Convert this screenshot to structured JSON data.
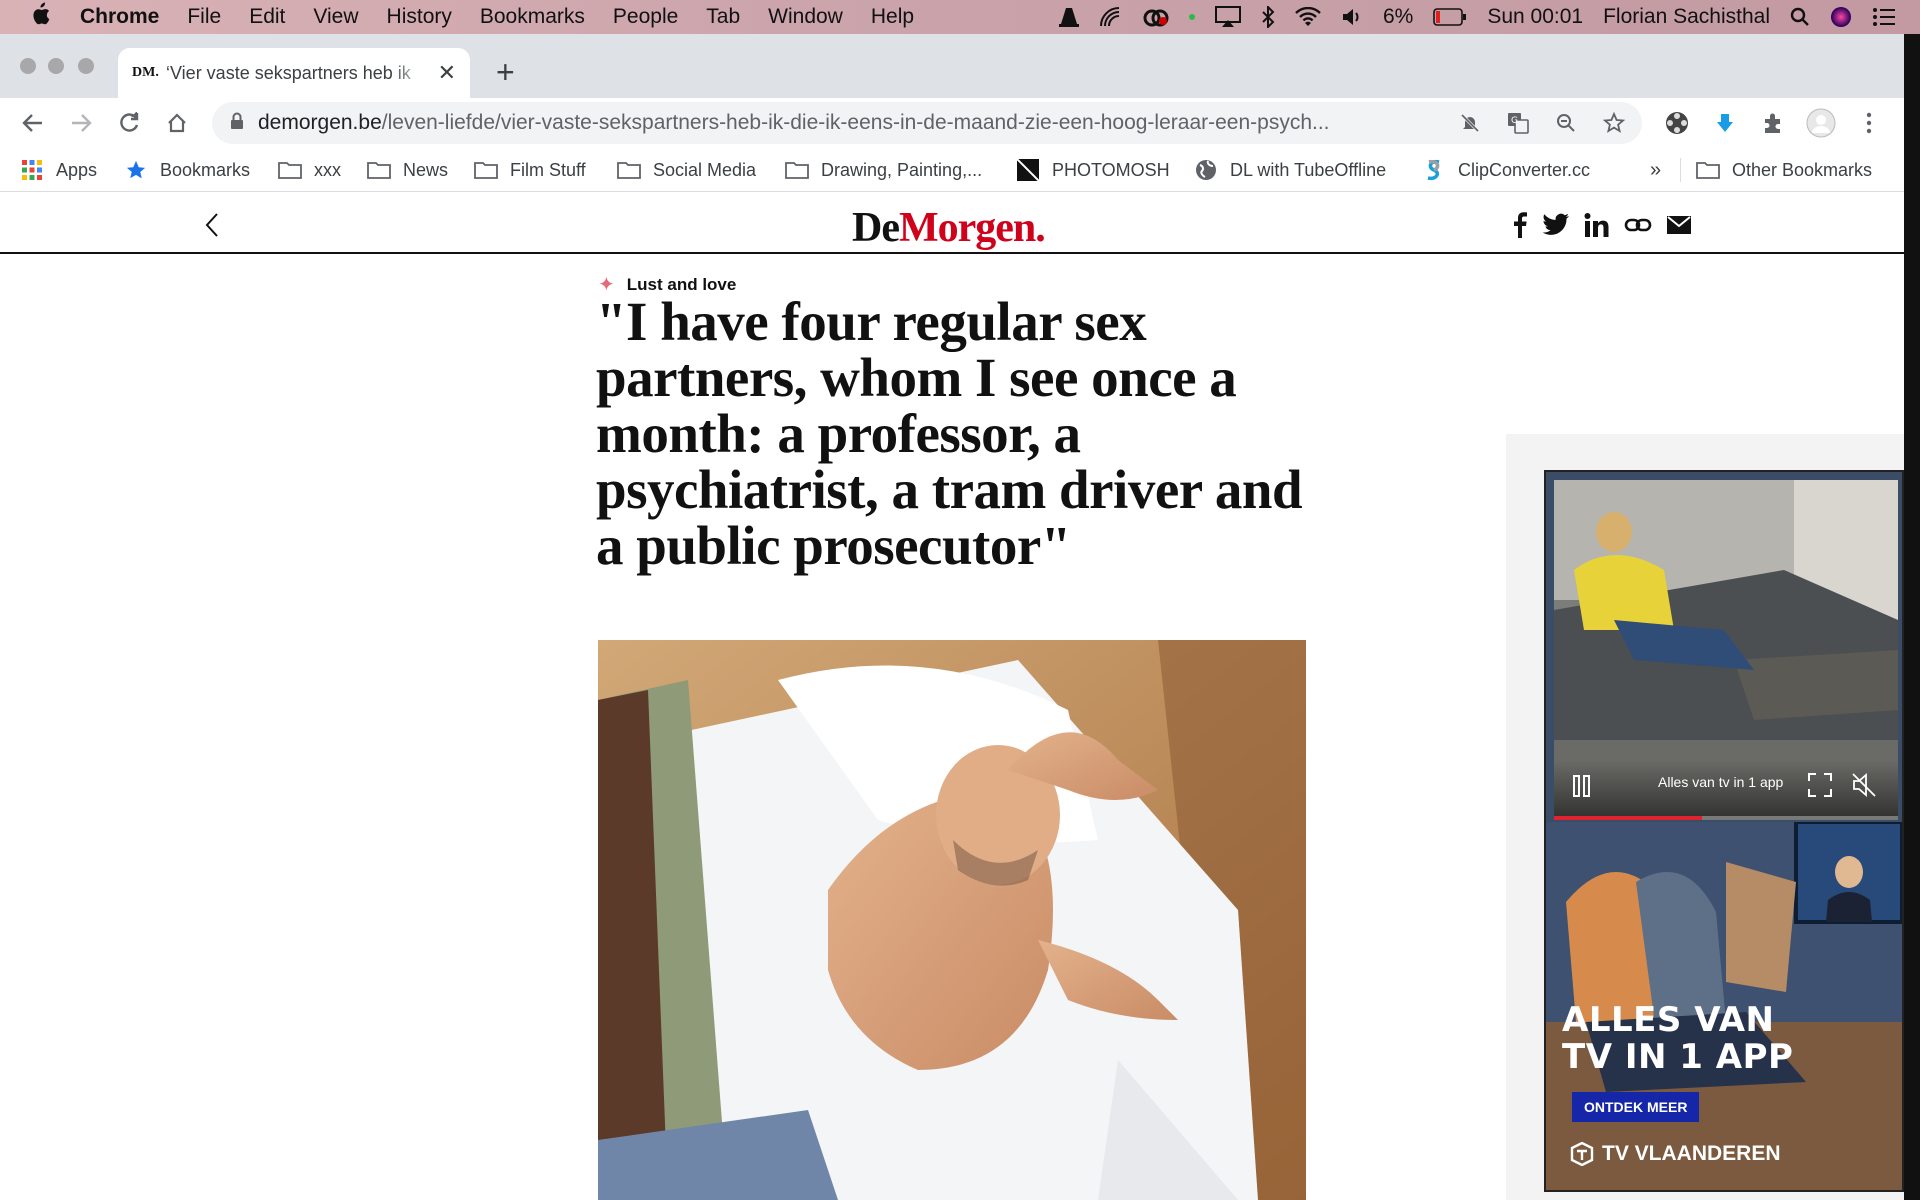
{
  "menubar": {
    "app_name": "Chrome",
    "items": [
      "File",
      "Edit",
      "View",
      "History",
      "Bookmarks",
      "People",
      "Tab",
      "Window",
      "Help"
    ],
    "battery": "6%",
    "clock": "Sun 00:01",
    "user": "Florian Sachisthal"
  },
  "tab": {
    "favicon_text": "DM.",
    "title": "‘Vier vaste sekspartners heb ik"
  },
  "address": {
    "host": "demorgen.be",
    "path": "/leven-liefde/vier-vaste-sekspartners-heb-ik-die-ik-eens-in-de-maand-zie-een-hoog-leraar-een-psych..."
  },
  "bookmarks": [
    {
      "label": "Apps",
      "icon": "apps-grid-icon"
    },
    {
      "label": "Bookmarks",
      "icon": "star-icon"
    },
    {
      "label": "xxx",
      "icon": "folder-icon"
    },
    {
      "label": "News",
      "icon": "folder-icon"
    },
    {
      "label": "Film Stuff",
      "icon": "folder-icon"
    },
    {
      "label": "Social Media",
      "icon": "folder-icon"
    },
    {
      "label": "Drawing, Painting,...",
      "icon": "folder-icon"
    },
    {
      "label": "PHOTOMOSH",
      "icon": "photomosh-icon"
    },
    {
      "label": "DL with TubeOffline",
      "icon": "globe-icon"
    },
    {
      "label": "ClipConverter.cc",
      "icon": "clipconverter-icon"
    }
  ],
  "bookmarks_overflow": "»",
  "other_bookmarks": "Other Bookmarks",
  "site": {
    "logo_de": "De",
    "logo_morgen": "Morgen",
    "logo_dot": "."
  },
  "article": {
    "kicker": "Lust and love",
    "headline": "\"I have four regular sex partners, whom I see once a month: a professor, a psychiatrist, a tram driver and a public prosecutor\""
  },
  "ad": {
    "video_caption": "Alles van tv in 1 app",
    "video_progress": 0.43,
    "title_line1": "ALLES VAN",
    "title_line2": "TV IN 1 APP",
    "button": "ONTDEK MEER",
    "brand": "TV VLAANDEREN"
  },
  "colors": {
    "brand_red": "#d0021b",
    "kicker_star": "#e56b7a",
    "ad_button": "#1626a8",
    "menubar": "#c9a2aa"
  }
}
